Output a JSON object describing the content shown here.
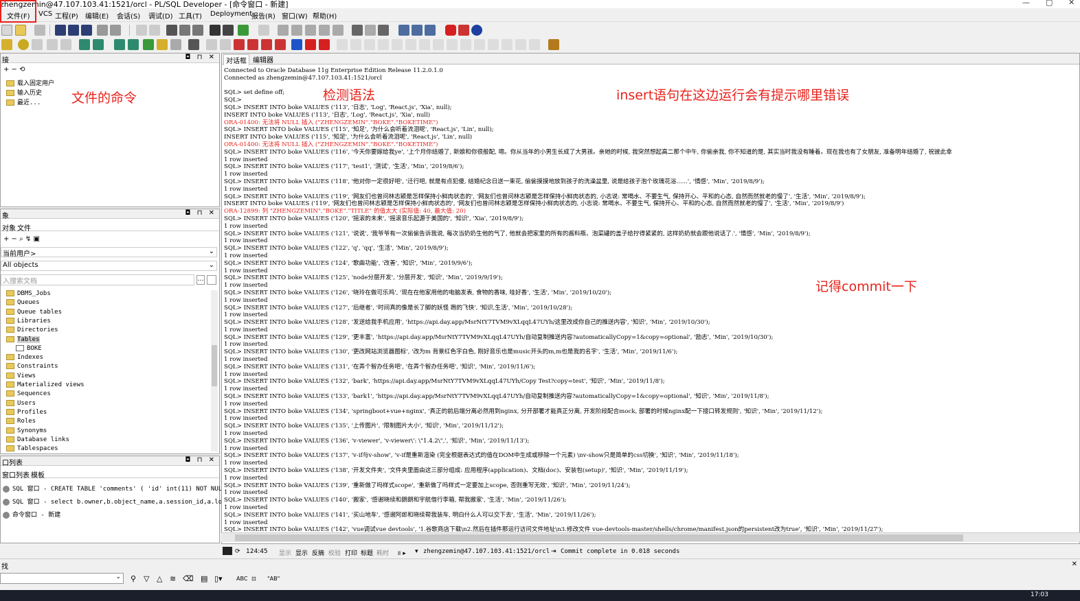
{
  "window": {
    "title": "zhengzemin@47.107.103.41:1521/orcl - PL/SQL Developer - [命令窗口 - 新建]",
    "controls": [
      "—",
      "▢",
      "✕"
    ]
  },
  "menu": [
    {
      "label": "文件(F)"
    },
    {
      "label": "VCS"
    },
    {
      "label": "工程(P)"
    },
    {
      "label": "编辑(E)"
    },
    {
      "label": "会话(S)"
    },
    {
      "label": "调试(D)"
    },
    {
      "label": "工具(T)"
    },
    {
      "label": "Deployment"
    },
    {
      "label": "报告(R)"
    },
    {
      "label": "窗口(W)"
    },
    {
      "label": "帮助(H)"
    }
  ],
  "file_panel": {
    "title": "接",
    "items": [
      "载入固定用户",
      "输入历史",
      "最近..."
    ]
  },
  "object_panel": {
    "title": "象",
    "tabs": [
      "对象",
      "文件"
    ],
    "user_select": "当前用户>",
    "filter_select": "All objects",
    "search_placeholder": "入搜索文档",
    "tree": [
      "DBMS_Jobs",
      "Queues",
      "Queue tables",
      "Libraries",
      "Directories",
      "Tables",
      "BOKE",
      "Indexes",
      "Constraints",
      "Views",
      "Materialized views",
      "Sequences",
      "Users",
      "Profiles",
      "Roles",
      "Synonyms",
      "Database links",
      "Tablespaces"
    ]
  },
  "window_list_panel": {
    "title": "口列表",
    "tabs": [
      "窗口列表",
      "模板"
    ],
    "items": [
      "SQL 窗口 - CREATE TABLE 'comments' ( 'id' int(11) NOT NULL A",
      "SQL 窗口 - select b.owner,b.object_name,a.session_id,a.locke",
      "命令窗口 - 新建"
    ]
  },
  "editor_tabs": [
    "对话框",
    "编辑器"
  ],
  "output_lines": [
    {
      "text": "Connected to Oracle Database 11g Enterprise Edition Release 11.2.0.1.0",
      "err": false
    },
    {
      "text": "Connected as zhengzemin@47.107.103.41:1521/orcl",
      "err": false
    },
    {
      "text": "",
      "err": false
    },
    {
      "text": "SQL> set define off;",
      "err": false
    },
    {
      "text": "SQL>",
      "err": false
    },
    {
      "text": "SQL> INSERT INTO boke VALUES ('113', '日志', 'Log', 'React.js', 'Xia', null);",
      "err": false
    },
    {
      "text": "INSERT INTO boke VALUES ('113', '日志', 'Log', 'React.js', 'Xia', null)",
      "err": false
    },
    {
      "text": "ORA-01400: 无法将 NULL 插入 (\"ZHENGZEMIN\".\"BOKE\".\"BOKETIME\")",
      "err": true
    },
    {
      "text": "SQL> INSERT INTO boke VALUES ('115', '知足', '为什么会听着流泪呢', 'React.js', 'Lin', null);",
      "err": false
    },
    {
      "text": "INSERT INTO boke VALUES ('115', '知足', '为什么会听着流泪呢', 'React.js', 'Lin', null)",
      "err": false
    },
    {
      "text": "ORA-01400: 无法将 NULL 插入 (\"ZHENGZEMIN\".\"BOKE\".\"BOKETIME\")",
      "err": true
    },
    {
      "text": "SQL> INSERT INTO boke VALUES ('116', '今天你要嫁给我ye', '上个月你结婚了, 新娘和你很般配, 嗯。你从当年的小男生长成了大男孩。亲她的时候, 我突然想起高二那个中午, 你偷亲我, 你不知道的是, 其实当时我没有睡着。现在我也有了女朋友, 准备明年结婚了, 祝彼此幸",
      "err": false
    },
    {
      "text": "1 row inserted",
      "err": false
    },
    {
      "text": "SQL> INSERT INTO boke VALUES ('117', 'test1', '测试', '生活', 'Min', '2019/8/6');",
      "err": false
    },
    {
      "text": "1 row inserted",
      "err": false
    },
    {
      "text": "SQL> INSERT INTO boke VALUES ('118', '他对你一定很好吧', '迁行吧, 就是有点犯傻, 结婚纪念日送一束花, 偷偷摸摸地放到孩子的洗澡盆里, 说是给孩子泡个玫瑰花浴......', '情感', 'Min', '2019/8/9');",
      "err": false
    },
    {
      "text": "1 row inserted",
      "err": false
    },
    {
      "text": "SQL> INSERT INTO boke VALUES ('119', '网友们也曾问林志颖是怎样保持小鲜肉状态的', '网友们也曾问林志颖是怎样保持小鲜肉状态的, 小志说: 常喝水、不要生气, 保持开心、平和的心态, 自然而然就老的慢了', '生活', 'Min', '2019/8/9');",
      "err": false
    },
    {
      "text": "INSERT INTO boke VALUES ('119', '网友们也曾问林志颖是怎样保持小鲜肉状态的', '网友们也曾问林志颖是怎样保持小鲜肉状态的, 小志说: 常喝水、不要生气, 保持开心、平和的心态, 自然而然就老的慢了', '生活', 'Min', '2019/8/9')",
      "err": false
    },
    {
      "text": "ORA-12899: 列 \"ZHENGZEMIN\".\"BOKE\".\"TITLE\" 的值太大 (实际值: 40, 最大值: 20)",
      "err": true
    },
    {
      "text": "SQL> INSERT INTO boke VALUES ('120', '摇滚的未来', '摇滚音乐起源于美国的', '知识', 'Xia', '2019/8/9');",
      "err": false
    },
    {
      "text": "1 row inserted",
      "err": false
    },
    {
      "text": "SQL> INSERT INTO boke VALUES ('121', '说说', '我爷爷有一次偷偷告诉我说, 每次当奶奶生他的气了, 他就会把家里的所有的酱料瓶、泡菜罐的盖子给拧得紧紧的, 这样奶奶就会跟他说话了.', '情感', 'Min', '2019/8/9');",
      "err": false
    },
    {
      "text": "1 row inserted",
      "err": false
    },
    {
      "text": "SQL> INSERT INTO boke VALUES ('122', 'q', 'qq', '生活', 'Min', '2019/8/9');",
      "err": false
    },
    {
      "text": "1 row inserted",
      "err": false
    },
    {
      "text": "SQL> INSERT INTO boke VALUES ('124', '歌曲功能', '改善', '知识', 'Min', '2019/9/6');",
      "err": false
    },
    {
      "text": "1 row inserted",
      "err": false
    },
    {
      "text": "SQL> INSERT INTO boke VALUES ('125', 'node分层开发', '分层开发', '知识', 'Min', '2019/9/19');",
      "err": false
    },
    {
      "text": "1 row inserted",
      "err": false
    },
    {
      "text": "SQL> INSERT INTO boke VALUES ('126', '晓玲在做可乐鸡', '现在在他家用他的电脑发表, 食物的香味, 哇好香', '生活', 'Min', '2019/10/20');",
      "err": false
    },
    {
      "text": "1 row inserted",
      "err": false
    },
    {
      "text": "SQL> INSERT INTO boke VALUES ('127', '后继者', '时间真的像是长了脚的妖怪 跑的飞快', '知识,生活', 'Min', '2019/10/28');",
      "err": false
    },
    {
      "text": "1 row inserted",
      "err": false
    },
    {
      "text": "SQL> INSERT INTO boke VALUES ('128', '发送给我手机应用', 'https://api.day.app/MsrNtY7TVM9vXLqqL47UYh/这里改成你自己的推送内容', '知识', 'Min', '2019/10/30');",
      "err": false
    },
    {
      "text": "1 row inserted",
      "err": false
    },
    {
      "text": "SQL> INSERT INTO boke VALUES ('129', '更丰富', 'https://api.day.app/MsrNtY7TVM9vXLqqL47UYh/自动复制推送内容?automaticallyCopy=1&copy=optional', '励志', 'Min', '2019/10/30');",
      "err": false
    },
    {
      "text": "1 row inserted",
      "err": false
    },
    {
      "text": "SQL> INSERT INTO boke VALUES ('130', '更改网站浏览器图标', '改为m 背景红色字白色, 刚好音乐也是music开头的m,m也是我的名字', '生活', 'Min', '2019/11/6');",
      "err": false
    },
    {
      "text": "1 row inserted",
      "err": false
    },
    {
      "text": "SQL> INSERT INTO boke VALUES ('131', '在弄个智办任务吧', '在弄个智办任务吧', '知识', 'Min', '2019/11/6');",
      "err": false
    },
    {
      "text": "1 row inserted",
      "err": false
    },
    {
      "text": "SQL> INSERT INTO boke VALUES ('132', 'bark', 'https://api.day.app/MsrNtY7TVM9vXLqqL47UYh/Copy Test?copy=test', '知识', 'Min', '2019/11/8');",
      "err": false
    },
    {
      "text": "1 row inserted",
      "err": false
    },
    {
      "text": "SQL> INSERT INTO boke VALUES ('133', 'bark1', 'https://api.day.app/MsrNtY7TVM9vXLqqL47UYh/自动复制推送内容?automaticallyCopy=1&copy=optional', '知识', 'Min', '2019/11/8');",
      "err": false
    },
    {
      "text": "1 row inserted",
      "err": false
    },
    {
      "text": "SQL> INSERT INTO boke VALUES ('134', 'springboot+vue+nginx', '真正的前后端分离必然用到nginx, 分开部署才能真正分离, 开发阶段配合mock, 部署的时候nginx配一下接口转发规则', '知识', 'Min', '2019/11/12');",
      "err": false
    },
    {
      "text": "1 row inserted",
      "err": false
    },
    {
      "text": "SQL> INSERT INTO boke VALUES ('135', '上传图片', '限制图片大小', '知识', 'Min', '2019/11/12');",
      "err": false
    },
    {
      "text": "1 row inserted",
      "err": false
    },
    {
      "text": "SQL> INSERT INTO boke VALUES ('136', 'v-viewer', 'v-viewer\\': \\\"1.4.2\\\",', '知识', 'Min', '2019/11/13');",
      "err": false
    },
    {
      "text": "1 row inserted",
      "err": false
    },
    {
      "text": "SQL> INSERT INTO boke VALUES ('137', 'v-if与v-show', 'v-if是重新渲染 (完全根据表达式的值在DOM中生成或移除一个元素) \\nv-show只是简单的css切换', '知识', 'Min', '2019/11/18');",
      "err": false
    },
    {
      "text": "1 row inserted",
      "err": false
    },
    {
      "text": "SQL> INSERT INTO boke VALUES ('138', '开发文件夹', '文件夹里面由这三部分组成: 应用程序(application)、文档(doc)、安装包(setup)', '知识', 'Min', '2019/11/19');",
      "err": false
    },
    {
      "text": "1 row inserted",
      "err": false
    },
    {
      "text": "SQL> INSERT INTO boke VALUES ('139', '重新做了吗样式scope', '重新做了吗样式一定要加上scope, 否则重写无效', '知识', 'Min', '2019/11/24');",
      "err": false
    },
    {
      "text": "1 row inserted",
      "err": false
    },
    {
      "text": "SQL> INSERT INTO boke VALUES ('140', '搬家', '感谢晓续和朗朗和宇航借行李箱, 帮我搬家', '生活', 'Min', '2019/11/26');",
      "err": false
    },
    {
      "text": "1 row inserted",
      "err": false
    },
    {
      "text": "SQL> INSERT INTO boke VALUES ('141', '买山地车', '感谢阿郎和晓续帮我装车, 明白什么人可以交下去', '生活', 'Min', '2019/11/26');",
      "err": false
    },
    {
      "text": "1 row inserted",
      "err": false
    },
    {
      "text": "SQL> INSERT INTO boke VALUES ('142', 'vue调试vue devtools', '1.谷歌商店下载\\n2.然后在插件那运行访问文件地址\\n3.修改文件 vue-devtools-master/shells/chrome/manifest.json的persistent改为true', '知识', 'Min', '2019/11/27');",
      "err": false
    }
  ],
  "annotations": {
    "file_commands": "文件的命令",
    "check_syntax": "检测语法",
    "insert_hint": "insert语句在这边运行会有提示哪里错误",
    "commit_reminder": "记得commit一下"
  },
  "status": {
    "position": "124:45",
    "labels": [
      "显示",
      "显示",
      "反摘",
      "校验",
      "打印",
      "标题",
      "耗时"
    ],
    "connection": "zhengzemin@47.107.103.41:1521/orcl",
    "message": "Commit complete in 0.018 seconds"
  },
  "find": {
    "title": "找",
    "abc": "ABC",
    "ab": "\"AB\""
  },
  "taskbar": {
    "time": "17:03"
  }
}
